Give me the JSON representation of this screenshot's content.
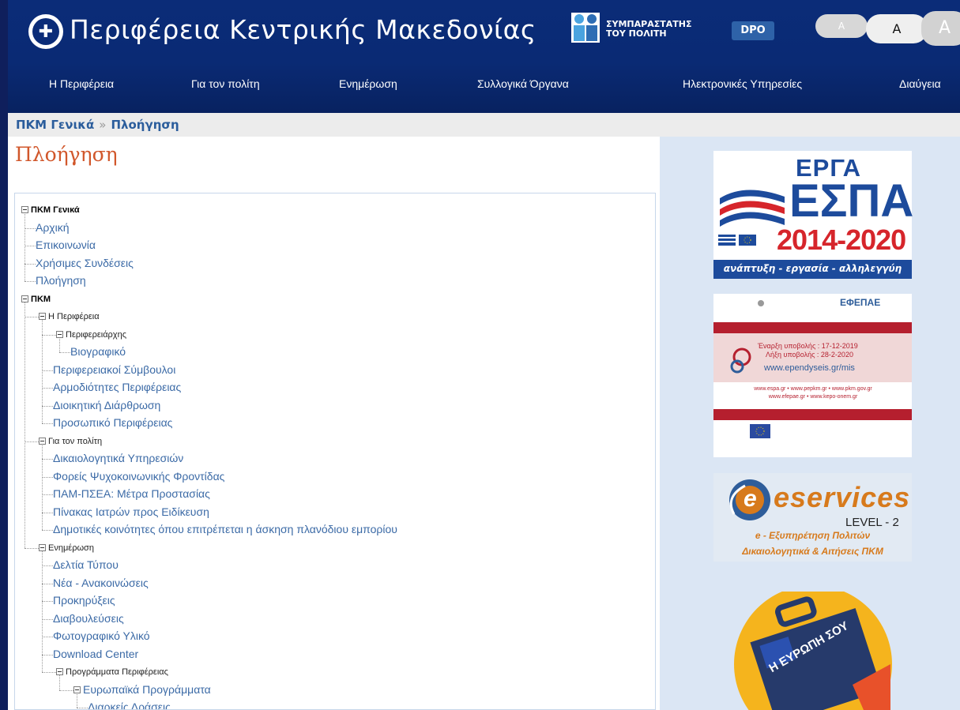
{
  "header": {
    "title": "Περιφέρεια Κεντρικής Μακεδονίας",
    "supporter_line1": "ΣΥΜΠΑΡΑΣΤΑΤΗΣ",
    "supporter_line2": "ΤΟΥ ΠΟΛΙΤΗ",
    "dpo": "DPO",
    "font_small": "A",
    "font_medium": "A",
    "font_large": "A"
  },
  "nav": {
    "items": [
      {
        "label": "Η Περιφέρεια"
      },
      {
        "label": "Για τον πολίτη"
      },
      {
        "label": "Ενημέρωση"
      },
      {
        "label": "Συλλογικά Όργανα"
      },
      {
        "label": "Ηλεκτρονικές Υπηρεσίες"
      },
      {
        "label": "Διαύγεια"
      }
    ]
  },
  "breadcrumb": {
    "first": "ΠΚΜ Γενικά",
    "separator": "»",
    "current": "Πλοήγηση"
  },
  "page": {
    "title": "Πλοήγηση"
  },
  "tree": [
    {
      "label": "ΠΚΜ Γενικά",
      "level": 0,
      "expanded": true
    },
    {
      "label": "Αρχική",
      "level": 1
    },
    {
      "label": "Επικοινωνία",
      "level": 1
    },
    {
      "label": "Χρήσιμες Συνδέσεις",
      "level": 1
    },
    {
      "label": "Πλοήγηση",
      "level": 1
    },
    {
      "label": "ΠΚΜ",
      "level": 0,
      "expanded": true
    },
    {
      "label": "Η Περιφέρεια",
      "level": 1,
      "expanded": true
    },
    {
      "label": "Περιφερειάρχης",
      "level": 2,
      "expanded": true
    },
    {
      "label": "Βιογραφικό",
      "level": 3
    },
    {
      "label": "Περιφερειακοί Σύμβουλοι",
      "level": 2
    },
    {
      "label": "Αρμοδιότητες Περιφέρειας",
      "level": 2
    },
    {
      "label": "Διοικητική Διάρθρωση",
      "level": 2
    },
    {
      "label": "Προσωπικό Περιφέρειας",
      "level": 2
    },
    {
      "label": "Για τον πολίτη",
      "level": 1,
      "expanded": true
    },
    {
      "label": "Δικαιολογητικά Υπηρεσιών",
      "level": 2
    },
    {
      "label": "Φορείς Ψυχοκοινωνικής Φροντίδας",
      "level": 2
    },
    {
      "label": "ΠΑΜ-ΠΣΕΑ: Μέτρα Προστασίας",
      "level": 2
    },
    {
      "label": "Πίνακας Ιατρών προς Ειδίκευση",
      "level": 2
    },
    {
      "label": "Δημοτικές κοινότητες όπου επιτρέπεται η άσκηση πλανόδιου εμπορίου",
      "level": 2
    },
    {
      "label": "Ενημέρωση",
      "level": 1,
      "expanded": true
    },
    {
      "label": "Δελτία Τύπου",
      "level": 2
    },
    {
      "label": "Νέα - Ανακοινώσεις",
      "level": 2
    },
    {
      "label": "Προκηρύξεις",
      "level": 2
    },
    {
      "label": "Διαβουλεύσεις",
      "level": 2
    },
    {
      "label": "Φωτογραφικό Υλικό",
      "level": 2
    },
    {
      "label": "Download Center",
      "level": 2
    },
    {
      "label": "Προγράμματα Περιφέρειας",
      "level": 2,
      "expanded": true
    },
    {
      "label": "Ευρωπαϊκά Προγράμματα",
      "level": 3,
      "expanded": true
    },
    {
      "label": "Διαρκείς Δράσεις",
      "level": 4
    }
  ],
  "banners": {
    "espa": {
      "line1": "ΕΡΓΑ",
      "line2": "ΕΣΠΑ",
      "line3": "2014-2020",
      "tagline": "ανάπτυξη - εργασία - αλληλεγγύη",
      "colors": {
        "blue": "#1d4b9c",
        "red": "#d6252b"
      }
    },
    "efepae": {
      "brand": "ΕΦΕΠΑΕ",
      "start": "Έναρξη υποβολής : 17-12-2019",
      "end": "Λήξη υποβολής : 28-2-2020",
      "url": "www.ependyseis.gr/mis",
      "links1": "www.espa.gr  •  www.pepkm.gr  •  www.pkm.gov.gr",
      "links2": "www.efepae.gr  •  www.kepo-onem.gr",
      "colors": {
        "band": "#b51f2e"
      }
    },
    "eservices": {
      "brand": "eservices",
      "level": "LEVEL - 2",
      "line1": "e - Εξυπηρέτηση Πολιτών",
      "line2": "Δικαιολογητικά & Αιτήσεις ΠΚΜ",
      "colors": {
        "orange": "#d77a1c",
        "blue": "#2e5d9a"
      }
    },
    "europe": {
      "text": "Η ΕΥΡΩΠΗ ΣΟΥ",
      "colors": {
        "yellow": "#f5b41d",
        "case": "#263a6b"
      }
    }
  }
}
